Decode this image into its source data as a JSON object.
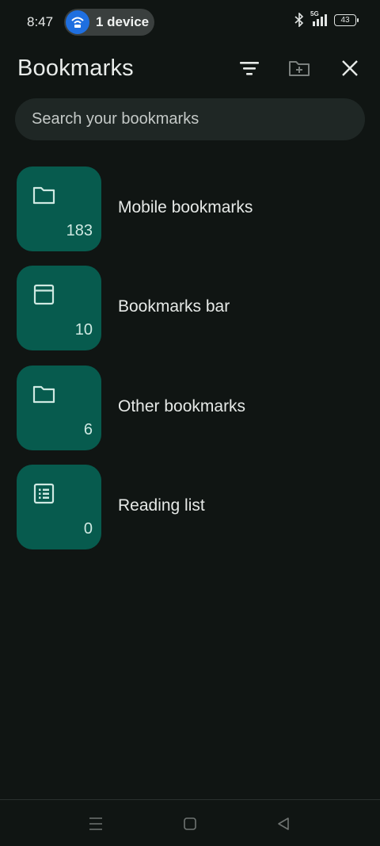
{
  "status_bar": {
    "time": "8:47",
    "hotspot_label": "1 device",
    "network": "5G",
    "battery": "43"
  },
  "app_bar": {
    "title": "Bookmarks",
    "icons": [
      "filter-icon",
      "new-folder-icon",
      "close-icon"
    ]
  },
  "search": {
    "placeholder": "Search your bookmarks"
  },
  "folders": [
    {
      "name": "Mobile bookmarks",
      "count": "183",
      "icon": "folder-icon"
    },
    {
      "name": "Bookmarks bar",
      "count": "10",
      "icon": "window-icon"
    },
    {
      "name": "Other bookmarks",
      "count": "6",
      "icon": "folder-icon"
    },
    {
      "name": "Reading list",
      "count": "0",
      "icon": "reading-list-icon"
    }
  ],
  "colors": {
    "background": "#101513",
    "tile": "#075b4e",
    "search_bg": "#1f2725"
  }
}
